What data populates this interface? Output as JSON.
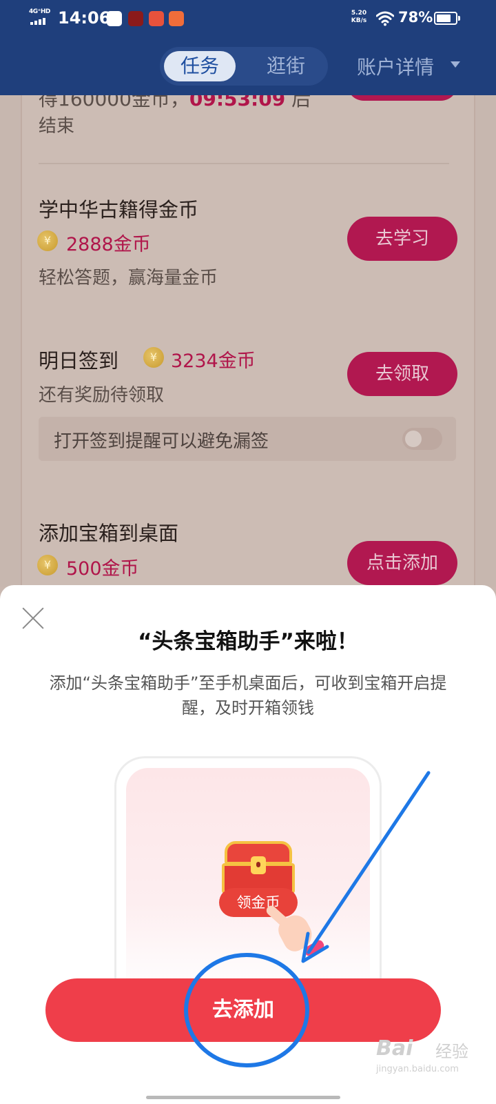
{
  "status_bar": {
    "network": "4G⁺HD",
    "time": "14:06",
    "speed_value": "5.20",
    "speed_unit": "KB/s",
    "battery": "78%"
  },
  "header": {
    "tabs": [
      {
        "label": "任务",
        "active": true
      },
      {
        "label": "逛街",
        "active": false
      }
    ],
    "account_label": "账户详情"
  },
  "tasks": {
    "partial": {
      "line1_prefix": "得160000金币，",
      "countdown": "09:53:09",
      "line1_suffix": " 后",
      "line2": "结束"
    },
    "items": [
      {
        "title": "学中华古籍得金币",
        "reward": "2888金币",
        "desc": "轻松答题，赢海量金币",
        "button": "去学习"
      },
      {
        "title": "明日签到",
        "reward": "3234金币",
        "desc": "还有奖励待领取",
        "button": "去领取"
      },
      {
        "title": "添加宝箱到桌面",
        "reward": "500金币",
        "button": "点击添加"
      }
    ],
    "reminder": {
      "text": "打开签到提醒可以避免漏签",
      "enabled": false
    },
    "coin_symbol": "¥"
  },
  "sheet": {
    "title": "“头条宝箱助手”来啦！",
    "description": "添加“头条宝箱助手”至手机桌面后，可收到宝箱开启提醒，及时开箱领钱",
    "preview_pill": "领金币",
    "cta": "去添加"
  },
  "watermark": {
    "main": "Bai",
    "cn": "经验",
    "sub": "jingyan.baidu.com"
  },
  "colors": {
    "header_bg": "#1f3f7c",
    "accent_red": "#ef3e4a",
    "task_button": "#b11850",
    "annotation_blue": "#1e78e6"
  }
}
